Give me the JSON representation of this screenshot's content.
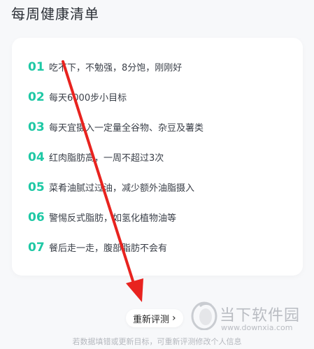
{
  "page": {
    "title": "每周健康清单"
  },
  "tips": [
    {
      "num": "01",
      "text": "吃不下，不勉强，8分饱，刚刚好"
    },
    {
      "num": "02",
      "text": "每天6000步小目标"
    },
    {
      "num": "03",
      "text": "每天宜摄入一定量全谷物、杂豆及薯类"
    },
    {
      "num": "04",
      "text": "红肉脂肪高，一周不超过3次"
    },
    {
      "num": "05",
      "text": "菜肴油腻过过油，减少额外油脂摄入"
    },
    {
      "num": "06",
      "text": "警惕反式脂肪，如氢化植物油等"
    },
    {
      "num": "07",
      "text": "餐后走一走，腹部脂肪不会有"
    }
  ],
  "actions": {
    "retest_label": "重新评测",
    "retest_icon": "chevron-right-icon"
  },
  "footer": {
    "hint": "若数据填错或更新目标，可重新评测修改个人信息"
  },
  "watermark": {
    "name": "当下软件园",
    "url": "www.downxia.com"
  },
  "colors": {
    "accent": "#1ec8a5",
    "arrow": "#e8231f",
    "background": "#f7f8fa"
  }
}
